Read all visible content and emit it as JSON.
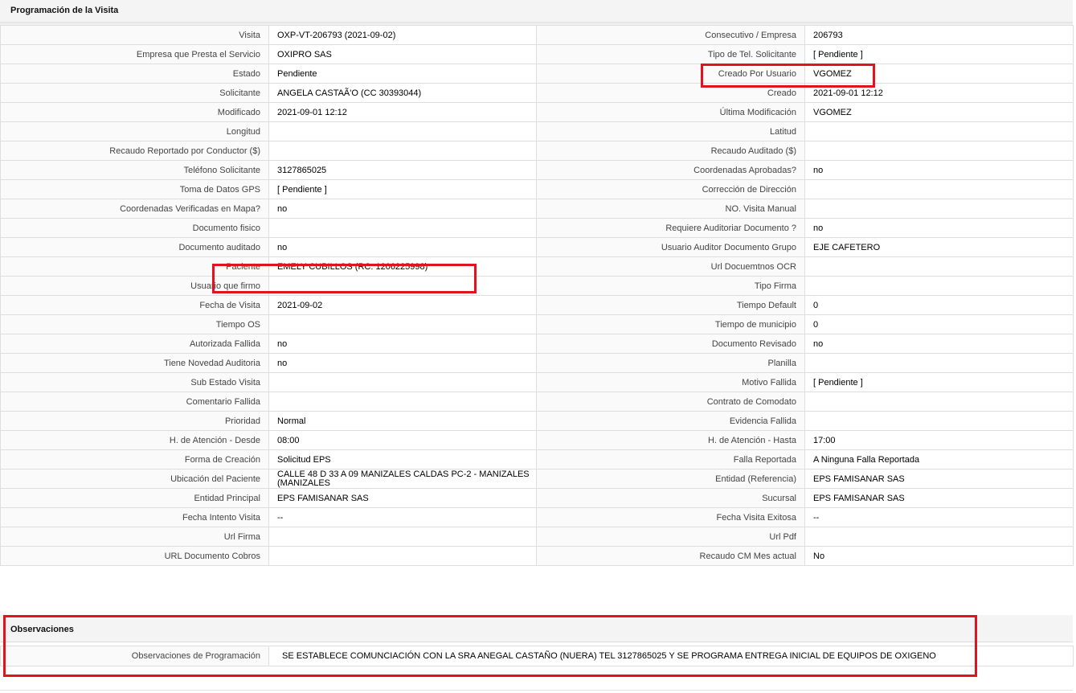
{
  "section_title": "Programación de la Visita",
  "rows": [
    {
      "l1": "Visita",
      "v1": "OXP-VT-206793 (2021-09-02)",
      "l2": "Consecutivo / Empresa",
      "v2": "206793"
    },
    {
      "l1": "Empresa que Presta el Servicio",
      "v1": "OXIPRO SAS",
      "l2": "Tipo de Tel. Solicitante",
      "v2": "[ Pendiente ]"
    },
    {
      "l1": "Estado",
      "v1": "Pendiente",
      "l2": "Creado Por Usuario",
      "v2": "VGOMEZ"
    },
    {
      "l1": "Solicitante",
      "v1": "ANGELA CASTAÃ'O (CC 30393044)",
      "l2": "Creado",
      "v2": "2021-09-01 12:12"
    },
    {
      "l1": "Modificado",
      "v1": "2021-09-01 12:12",
      "l2": "Última Modificación",
      "v2": "VGOMEZ"
    },
    {
      "l1": "Longitud",
      "v1": "",
      "l2": "Latitud",
      "v2": ""
    },
    {
      "l1": "Recaudo Reportado por Conductor ($)",
      "v1": "",
      "l2": "Recaudo Auditado ($)",
      "v2": ""
    },
    {
      "l1": "Teléfono Solicitante",
      "v1": "3127865025",
      "l2": "Coordenadas Aprobadas?",
      "v2": "no"
    },
    {
      "l1": "Toma de Datos GPS",
      "v1": "[ Pendiente ]",
      "l2": "Corrección de Dirección",
      "v2": ""
    },
    {
      "l1": "Coordenadas Verificadas en Mapa?",
      "v1": "no",
      "l2": "NO. Visita Manual",
      "v2": ""
    },
    {
      "l1": "Documento fisico",
      "v1": "",
      "l2": "Requiere Auditoriar Documento ?",
      "v2": "no"
    },
    {
      "l1": "Documento auditado",
      "v1": "no",
      "l2": "Usuario Auditor Documento Grupo",
      "v2": "EJE CAFETERO"
    },
    {
      "l1": "Paciente",
      "v1": "EMELY CUBILLOS (RC: 1206225998)",
      "l2": "Url Docuemtnos OCR",
      "v2": ""
    },
    {
      "l1": "Usuario que firmo",
      "v1": "",
      "l2": "Tipo Firma",
      "v2": ""
    },
    {
      "l1": "Fecha de Visita",
      "v1": "2021-09-02",
      "l2": "Tiempo Default",
      "v2": "0"
    },
    {
      "l1": "Tiempo OS",
      "v1": "",
      "l2": "Tiempo de municipio",
      "v2": "0"
    },
    {
      "l1": "Autorizada Fallida",
      "v1": "no",
      "l2": "Documento Revisado",
      "v2": "no"
    },
    {
      "l1": "Tiene Novedad Auditoria",
      "v1": "no",
      "l2": "Planilla",
      "v2": ""
    },
    {
      "l1": "Sub Estado Visita",
      "v1": "",
      "l2": "Motivo Fallida",
      "v2": "[ Pendiente ]"
    },
    {
      "l1": "Comentario Fallida",
      "v1": "",
      "l2": "Contrato de Comodato",
      "v2": ""
    },
    {
      "l1": "Prioridad",
      "v1": "Normal",
      "l2": "Evidencia Fallida",
      "v2": ""
    },
    {
      "l1": "H. de Atención - Desde",
      "v1": "08:00",
      "l2": "H. de Atención - Hasta",
      "v2": "17:00"
    },
    {
      "l1": "Forma de Creación",
      "v1": "Solicitud EPS",
      "l2": "Falla Reportada",
      "v2": "A Ninguna Falla Reportada"
    },
    {
      "l1": "Ubicación del Paciente",
      "v1": "CALLE 48 D 33 A 09 MANIZALES CALDAS PC-2 - MANIZALES (MANIZALES",
      "l2": "Entidad (Referencia)",
      "v2": "EPS FAMISANAR SAS"
    },
    {
      "l1": "Entidad Principal",
      "v1": "EPS FAMISANAR SAS",
      "l2": "Sucursal",
      "v2": "EPS FAMISANAR SAS"
    },
    {
      "l1": "Fecha Intento Visita",
      "v1": "--",
      "l2": "Fecha Visita Exitosa",
      "v2": "--"
    },
    {
      "l1": "Url Firma",
      "v1": "",
      "l2": "Url Pdf",
      "v2": ""
    },
    {
      "l1": "URL Documento Cobros",
      "v1": "",
      "l2": "Recaudo CM Mes actual",
      "v2": "No"
    }
  ],
  "observaciones": {
    "title": "Observaciones",
    "label": "Observaciones de Programación",
    "value": "SE ESTABLECE COMUNCIACIÓN CON LA SRA ANEGAL CASTAÑO (NUERA) TEL 3127865025 Y SE PROGRAMA ENTREGA INICIAL DE EQUIPOS DE OXIGENO"
  },
  "highlight_color": "#e0141e"
}
